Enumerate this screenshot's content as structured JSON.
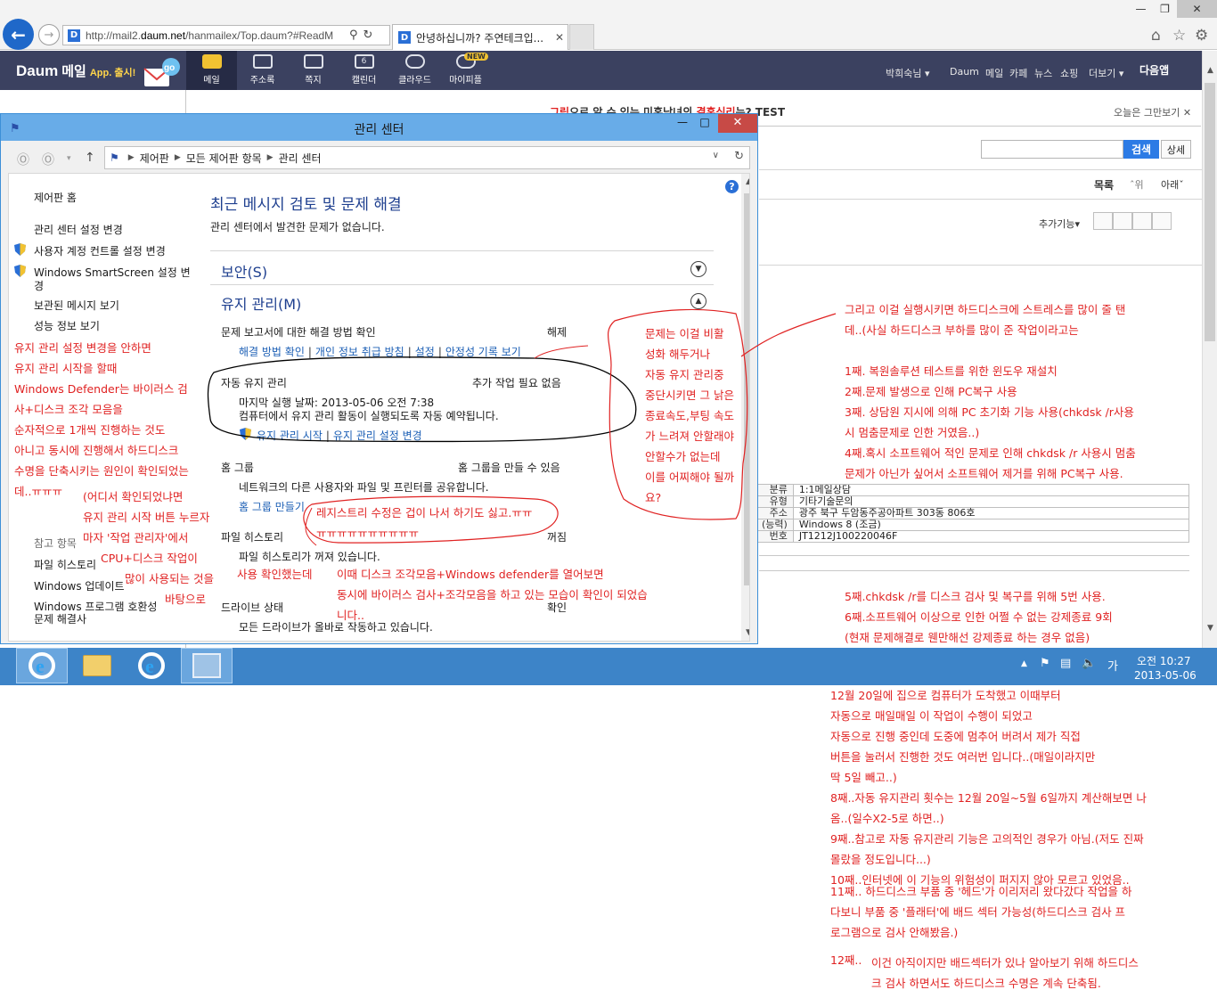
{
  "browser": {
    "url": "http://mail2.daum.net/hanmailex/Top.daum?#ReadM",
    "url_prefix": "http://mail2.",
    "url_domain": "daum.net",
    "url_rest": "/hanmailex/Top.daum?#ReadM",
    "tab_title": "안녕하십니까? 주연테크입...",
    "site_icon": "D",
    "back_icon": "back-arrow-icon",
    "icons": [
      "home-icon",
      "star-icon",
      "gear-icon"
    ]
  },
  "daum": {
    "logo": "Daum",
    "logo_mail": "메일",
    "logo_app": "App. 출시!",
    "go_badge": "go",
    "nav": [
      {
        "label": "메일"
      },
      {
        "label": "주소록"
      },
      {
        "label": "쪽지"
      },
      {
        "label": "캘린더"
      },
      {
        "label": "클라우드"
      },
      {
        "label": "마이피플"
      }
    ],
    "new_badge": "NEW",
    "calendar_day": "6",
    "user": "박희숙님",
    "links": [
      "Daum",
      "메일",
      "카페",
      "뉴스",
      "쇼핑",
      "더보기"
    ],
    "app_button": "다음앱"
  },
  "mail": {
    "ad_prefix": "그림",
    "ad_middle": "으로 알 수 있는 미혼남녀의 ",
    "ad_keyword": "결혼심리",
    "ad_suffix": "는? TEST",
    "ad_close": "오늘은 그만보기",
    "search_button": "검색",
    "detail_button": "상세",
    "list_button": "목록",
    "up_button": "위",
    "down_button": "아래",
    "extra_button": "추가기능",
    "info_rows": [
      {
        "key": "분류",
        "value": "1:1메일상담"
      },
      {
        "key": "유형",
        "value": "기타기술문의"
      },
      {
        "key": "주소",
        "value": "광주 북구 두암동주공아파트 303동 806호"
      },
      {
        "key": "(능력)",
        "value": "Windows 8 (조금)"
      },
      {
        "key": "번호",
        "value": "JT1212J100220046F"
      }
    ]
  },
  "action_center": {
    "title": "관리 센터",
    "breadcrumb": [
      "제어판",
      "모든 제어판 항목",
      "관리 센터"
    ],
    "help": "?",
    "sidebar": {
      "home": "제어판 홈",
      "items": [
        "관리 센터 설정 변경",
        "사용자 계정 컨트롤 설정 변경",
        "Windows SmartScreen 설정 변",
        "경",
        "보관된 메시지 보기",
        "성능 정보 보기"
      ],
      "see_also": "참고 항목",
      "see_also_items": [
        "파일 히스토리",
        "Windows 업데이트",
        "Windows 프로그램 호환성",
        "문제 해결사"
      ]
    },
    "main_title": "최근 메시지 검토 및 문제 해결",
    "main_subtitle": "관리 센터에서 발견한 문제가 없습니다.",
    "security_header": "보안(S)",
    "maintenance_header": "유지 관리(M)",
    "problem_reports": {
      "label": "문제 보고서에 대한 해결 방법 확인",
      "status": "해제",
      "links": [
        "해결 방법 확인",
        "개인 정보 취급 방침",
        "설정",
        "안정성 기록 보기"
      ]
    },
    "auto_maintenance": {
      "label": "자동 유지 관리",
      "status": "추가 작업 필요 없음",
      "last_run": "마지막 실행 날짜: 2013-05-06 오전 7:38",
      "description": "컴퓨터에서 유지 관리 활동이 실행되도록 자동 예약됩니다.",
      "links": [
        "유지 관리 시작",
        "유지 관리 설정 변경"
      ]
    },
    "homegroup": {
      "label": "홈 그룹",
      "status": "홈 그룹을 만들 수 있음",
      "description": "네트워크의 다른 사용자와 파일 및 프린터를 공유합니다.",
      "link": "홈 그룹 만들기"
    },
    "file_history": {
      "label": "파일 히스토리",
      "status": "꺼짐",
      "description": "파일 히스토리가 꺼져 있습니다."
    },
    "drive_status": {
      "label": "드라이브 상태",
      "status": "확인",
      "description": "모든 드라이브가 올바로 작동하고 있습니다."
    }
  },
  "annotations": {
    "left": [
      "유지 관리 설정 변경을 안하면",
      "유지 관리 시작을 할때",
      "Windows Defender는 바이러스 검",
      "사+디스크 조각 모음을",
      "순자적으로 1개씩 진행하는 것도",
      "아니고 동시에 진행해서 하드디스크",
      "수명을 단축시키는 원인이 확인되었는",
      "데..ㅠㅠㅠ"
    ],
    "where_confirmed": [
      "(어디서 확인되었냐면",
      "유지 관리 시작 버튼 누르자",
      "마자 '작업 관리자'에서",
      "CPU+디스크 작업이",
      "많이 사용되는 것을",
      "바탕으로",
      "사용  확인했는데"
    ],
    "defender_note": [
      "이때 디스크 조각모음+Windows defender를 열어보면",
      "동시에 바이러스 검사+조각모음을 하고 있는 모습이 확인이 되었습",
      "니다.."
    ],
    "middle": [
      "문제는 이걸 비활",
      "성화 해두거나",
      "자동 유지 관리중",
      "중단시키면 그 낡은",
      "종료속도,부팅 속도",
      "가 느려져 안할래야",
      "안할수가 없는데",
      "이를 어찌해야 될까",
      "요?"
    ],
    "registry": [
      "레지스트리 수정은 겁이 나서 하기도 싫고.ㅠㅠ",
      "ㅠㅠㅠㅠㅠㅠㅠㅠㅠㅠ"
    ],
    "right_top": [
      "그리고 이걸 실행시키면 하드디스크에 스트레스를 많이 줄 탠",
      "데..(사실 하드디스크 부하를 많이 준 작업이라고는"
    ],
    "right_list": [
      "1째. 복원솔루션 테스트를 위한 윈도우 재설치",
      "2째.문제 발생으로 인해 PC복구 사용",
      "3째. 상담원 지시에 의해 PC 초기화 기능 사용(chkdsk /r사용",
      "시 멈춤문제로 인한 거였음..)",
      "4째.혹시 소프트웨어 적인 문제로 인해 chkdsk /r 사용시 멈춤",
      "문제가 아닌가 싶어서 소프트웨어 제거를 위해 PC복구 사용."
    ],
    "right_list2": [
      "5째.chkdsk /r를 디스크 검사 및 복구를 위해 5번 사용.",
      "6째.소프트웨어 이상으로 인한 어쩔 수 없는 강제종료 9회",
      "(현재 문제해결로 웬만해선 강제종료 하는 경우 없음)"
    ],
    "bottom": [
      "12월 20일에 집으로 컴퓨터가 도착했고 이때부터",
      "자동으로 매일매일 이 작업이 수행이 되었고",
      "자동으로 진행 중인데 도중에 멈추어 버려서 제가 직접",
      "버튼을 눌러서 진행한 것도 여러번 입니다..(매일이라지만",
      "딱 5일 빼고..)",
      "8째..자동 유지관리 횟수는 12월 20일~5월 6일까지 계산해보면 나",
      "옴..(일수X2-5로 하면..)",
      "9째..참고로 자동 유지관리 기능은 고의적인 경우가 아님.(저도 진짜",
      "몰랐을 정도입니다...)",
      "10째..인터넷에 이 기능의 위험성이 퍼지지 않아 모르고 있었음..",
      "11째.. 하드디스크 부품 중 '헤드'가 이리저리 왔다갔다 작업을 하",
      "다보니 부품 중 '플래터'에 배드 섹터 가능성(하드디스크 검사 프",
      "로그램으로 검사 안해봤음.)"
    ],
    "last_num": "12째..",
    "last": [
      "이건 아직이지만 배드섹터가 있나 알아보기 위해 하드디스",
      "크 검사 하면서도 하드디스크 수명은 계속 단축됨."
    ]
  },
  "taskbar": {
    "ime": "가",
    "time": "오전 10:27",
    "date": "2013-05-06"
  },
  "colors": {
    "annotation": "#e02222",
    "link": "#1c5fb5",
    "title_bar": "#68ace8",
    "taskbar": "#3d84c8",
    "daum_header": "#3b4160"
  }
}
